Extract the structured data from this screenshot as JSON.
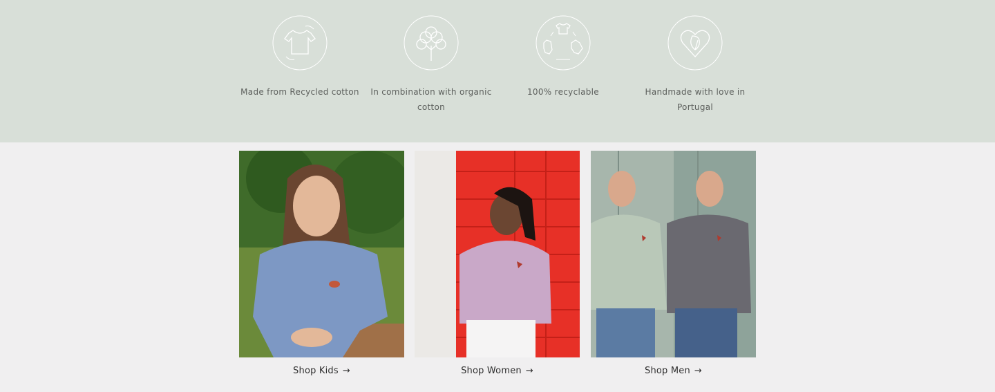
{
  "features": [
    {
      "icon": "recycled-tshirt-icon",
      "label": "Made from Recycled cotton"
    },
    {
      "icon": "cotton-plant-icon",
      "label": "In combination with organic cotton"
    },
    {
      "icon": "recycle-clothes-icon",
      "label": "100% recyclable"
    },
    {
      "icon": "heart-leaf-icon",
      "label": "Handmade with love in Portugal"
    }
  ],
  "cards": [
    {
      "label": "Shop Kids",
      "arrow": "→"
    },
    {
      "label": "Shop Women",
      "arrow": "→"
    },
    {
      "label": "Shop Men",
      "arrow": "→"
    }
  ],
  "colors": {
    "feature_bg": "#d8dfd8",
    "page_bg": "#f0eff0",
    "icon_stroke": "#ffffff"
  }
}
